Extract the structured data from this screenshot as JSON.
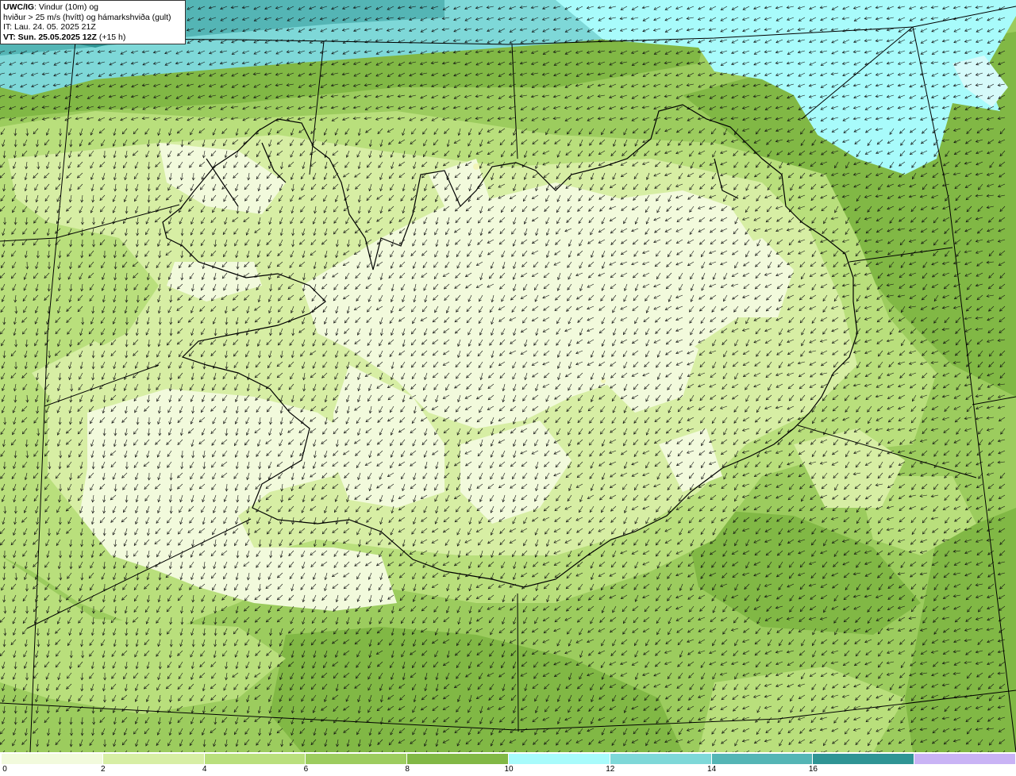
{
  "header": {
    "product_code": "UWC/IG",
    "title_line1": ": Vindur (10m) og",
    "title_line2": "hviður > 25 m/s (hvítt) og hámarkshviða (gult)",
    "initial_time": "IT: Lau. 24. 05. 2025 21Z",
    "valid_time_label": "VT: Sun. 25.05.2025 12Z",
    "lead_time": "(+15 h)"
  },
  "legend": {
    "unit_note": "",
    "ticks": [
      "0",
      "2",
      "4",
      "6",
      "8",
      "10",
      "12",
      "14",
      "16"
    ],
    "colors": [
      "#f2fadc",
      "#d7eea4",
      "#b9df7c",
      "#9ccc5e",
      "#81b845",
      "#a8fbfb",
      "#7ed8d8",
      "#54b5b5",
      "#2f9494",
      "#c9b3f5"
    ]
  },
  "map": {
    "region": "Ísland",
    "wind_direction": "mostly from north / northeast",
    "field_colors": {
      "calm": "#f2fadc",
      "light": "#d7eea4",
      "moderate": "#b9df7c",
      "fresh": "#9ccc5e",
      "strong": "#81b845",
      "gale_light": "#a8fbfb",
      "gale": "#7ed8d8",
      "gale_dark": "#54b5b5"
    }
  }
}
